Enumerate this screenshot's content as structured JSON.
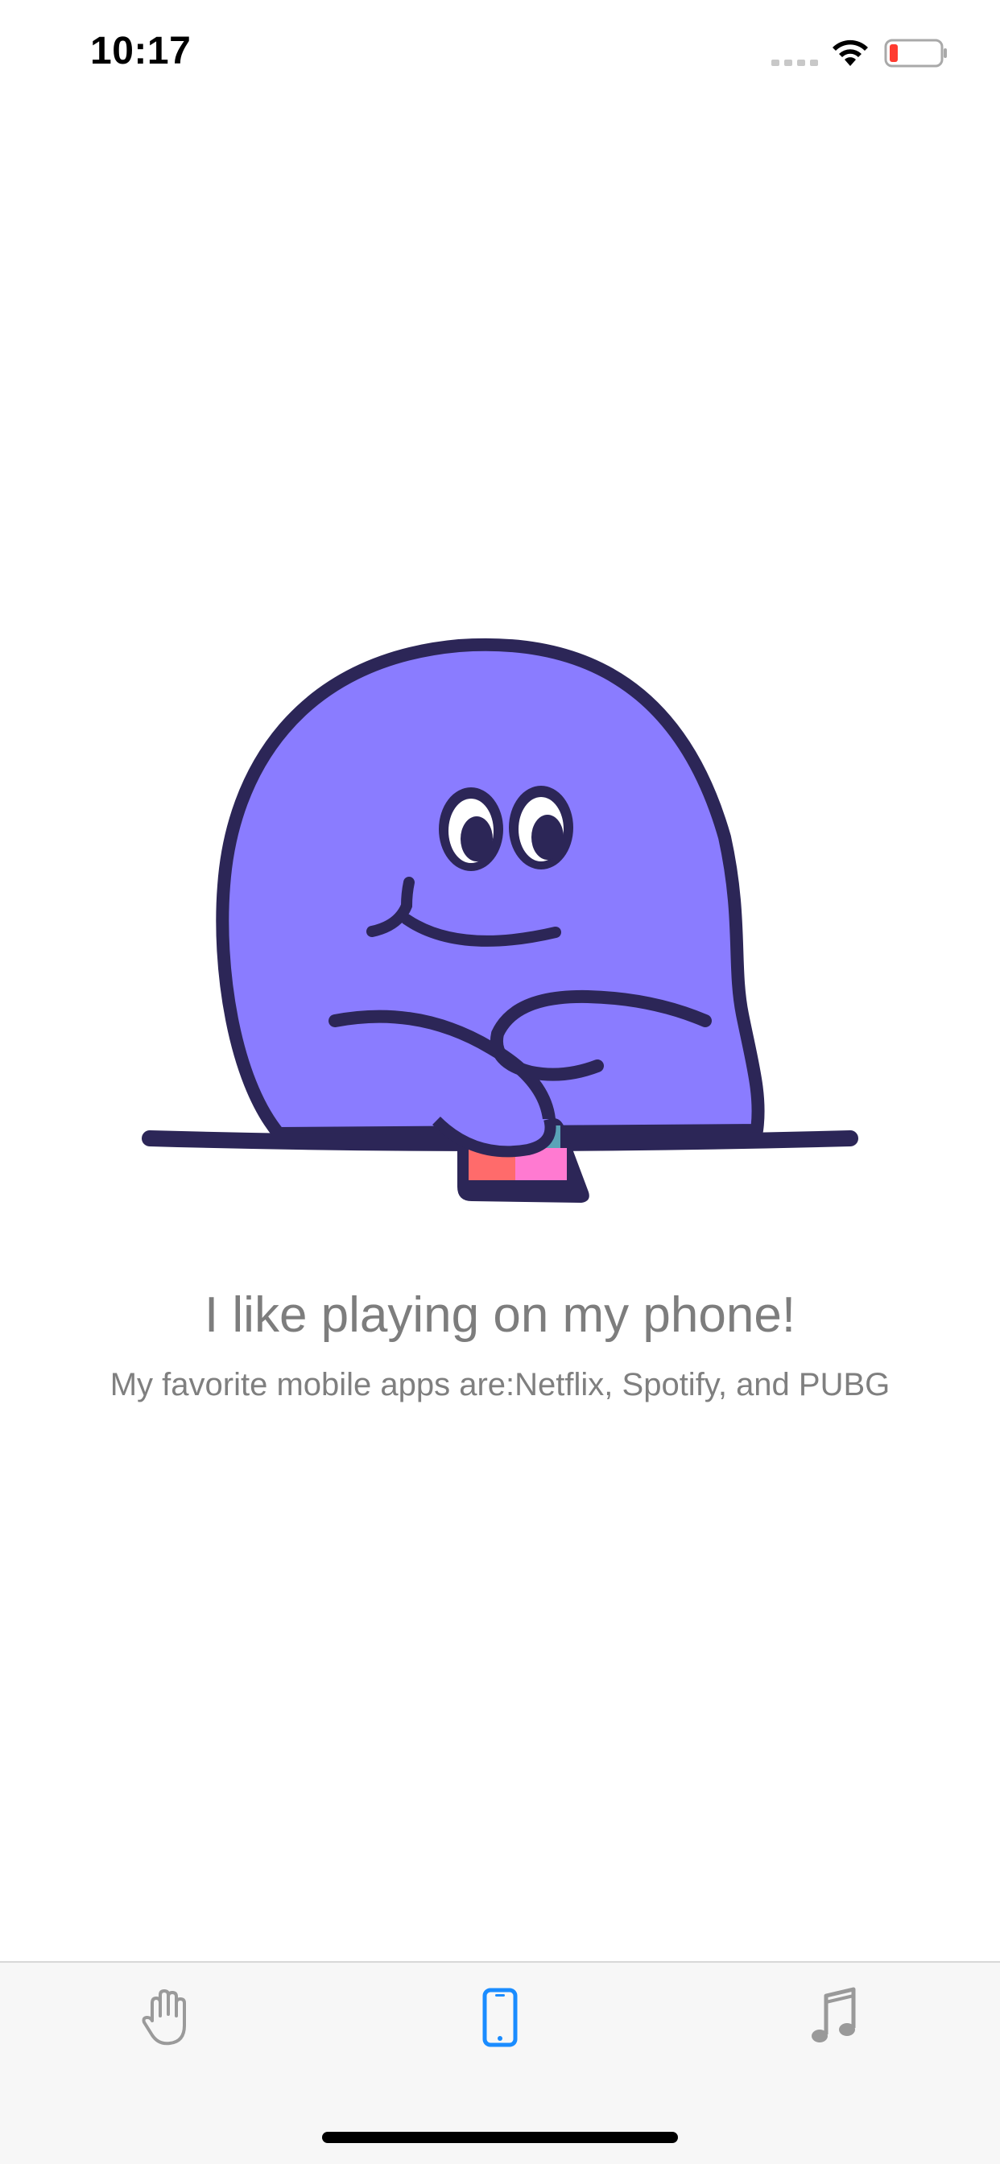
{
  "status_bar": {
    "time": "10:17",
    "battery_color": "#ff3b30"
  },
  "content": {
    "title": "I like playing on my phone!",
    "subtitle": "My favorite mobile apps are:Netflix, Spotify, and PUBG"
  },
  "illustration": {
    "icon": "purple-blob-character-playing-phone",
    "body_color": "#8a7cff",
    "outline_color": "#2c2657"
  },
  "tab_bar": {
    "tabs": [
      {
        "icon": "hand-icon",
        "selected": false
      },
      {
        "icon": "phone-icon",
        "selected": true
      },
      {
        "icon": "music-note-icon",
        "selected": false
      }
    ],
    "selected_color": "#1a8cff",
    "unselected_color": "#9a9a9a"
  }
}
